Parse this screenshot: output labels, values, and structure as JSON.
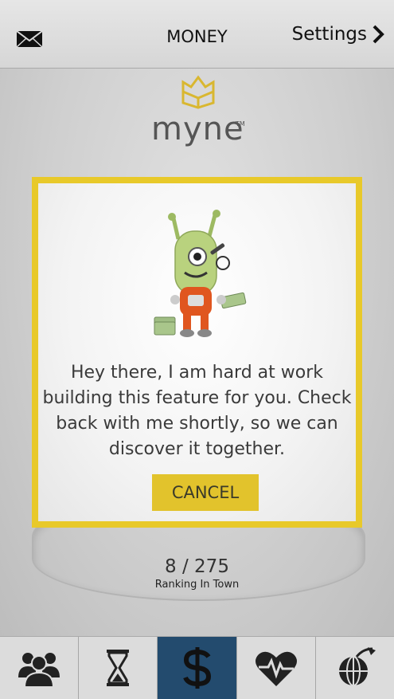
{
  "header": {
    "title": "MONEY",
    "settings_label": "Settings"
  },
  "logo": {
    "text": "myne",
    "tm": "TM"
  },
  "modal": {
    "message": "Hey there, I am hard at work building this feature for you. Check back with me shortly, so we can discover it together.",
    "cancel_label": "CANCEL"
  },
  "ranking": {
    "value": "8 / 275",
    "label": "Ranking In Town"
  },
  "tabs": [
    {
      "icon": "people-icon"
    },
    {
      "icon": "hourglass-icon"
    },
    {
      "icon": "dollar-icon",
      "active": true
    },
    {
      "icon": "heartbeat-icon"
    },
    {
      "icon": "globe-plane-icon"
    }
  ],
  "colors": {
    "accent": "#e8c92a",
    "active_tab": "#234b6e",
    "button": "#e2c32c"
  }
}
